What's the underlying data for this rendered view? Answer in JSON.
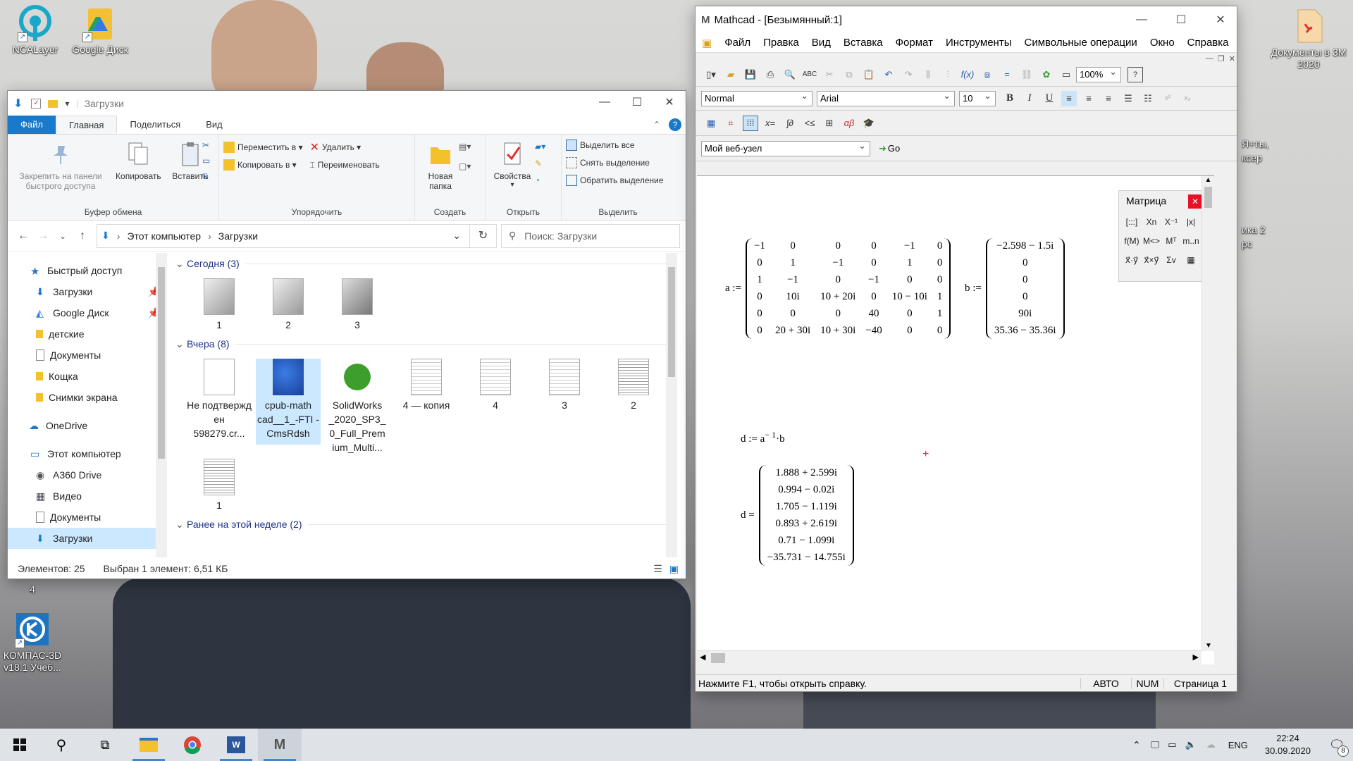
{
  "desktop": {
    "icons": [
      {
        "label": "NCALayer",
        "icon": "ncalayer-icon"
      },
      {
        "label": "Google Диск",
        "icon": "google-drive-icon"
      },
      {
        "label": "КОМПАС-3D v18.1 Учеб...",
        "icon": "kompas-icon"
      },
      {
        "label": "Документы в 3М 2020",
        "icon": "pdf-doc-icon"
      }
    ],
    "partial_labels": [
      "Я+ты,",
      "ксер",
      "ика 2",
      "рс",
      "4"
    ]
  },
  "explorer": {
    "title": "Загрузки",
    "tabs": [
      "Файл",
      "Главная",
      "Поделиться",
      "Вид"
    ],
    "ribbon": {
      "clipboard": {
        "pin_label": "Закрепить на панели быстрого доступа",
        "copy_label": "Копировать",
        "paste_label": "Вставить",
        "group_label": "Буфер обмена"
      },
      "organize": {
        "move_label": "Переместить в",
        "copy_to_label": "Копировать в",
        "delete_label": "Удалить",
        "rename_label": "Переименовать",
        "group_label": "Упорядочить"
      },
      "create": {
        "new_folder_label": "Новая папка",
        "group_label": "Создать"
      },
      "open": {
        "properties_label": "Свойства",
        "group_label": "Открыть"
      },
      "select": {
        "select_all": "Выделить все",
        "deselect": "Снять выделение",
        "invert": "Обратить выделение",
        "group_label": "Выделить"
      }
    },
    "address": {
      "crumbs": [
        "Этот компьютер",
        "Загрузки"
      ],
      "search_placeholder": "Поиск: Загрузки"
    },
    "nav": [
      {
        "label": "Быстрый доступ",
        "icon": "star-icon"
      },
      {
        "label": "Загрузки",
        "icon": "download-icon",
        "pinned": true
      },
      {
        "label": "Google Диск",
        "icon": "google-drive-icon",
        "pinned": true
      },
      {
        "label": "детские",
        "icon": "folder-icon"
      },
      {
        "label": "Документы",
        "icon": "documents-icon"
      },
      {
        "label": "Кощка",
        "icon": "folder-icon"
      },
      {
        "label": "Снимки экрана",
        "icon": "folder-icon"
      },
      {
        "label": "OneDrive",
        "icon": "cloud-icon"
      },
      {
        "label": "Этот компьютер",
        "icon": "computer-icon"
      },
      {
        "label": "A360 Drive",
        "icon": "drive-icon"
      },
      {
        "label": "Видео",
        "icon": "video-icon"
      },
      {
        "label": "Документы",
        "icon": "documents-icon"
      },
      {
        "label": "Загрузки",
        "icon": "download-icon",
        "selected": true
      }
    ],
    "groups": [
      {
        "name": "Сегодня (3)",
        "items": [
          "1",
          "2",
          "3"
        ]
      },
      {
        "name": "Вчера (8)",
        "items": [
          "Не подтвержд ен 598279.cr...",
          "cpub-math cad__1_-FTI -CmsRdsh",
          "SolidWorks _2020_SP3_ 0_Full_Prem ium_Multi...",
          "4 — копия",
          "4",
          "3",
          "2",
          "1"
        ]
      },
      {
        "name": "Ранее на этой неделе (2)",
        "items": []
      }
    ],
    "status": {
      "count": "Элементов: 25",
      "selection": "Выбран 1 элемент: 6,51 КБ"
    }
  },
  "mathcad": {
    "title": "Mathcad - [Безымянный:1]",
    "menu": [
      "Файл",
      "Правка",
      "Вид",
      "Вставка",
      "Формат",
      "Инструменты",
      "Символьные операции",
      "Окно",
      "Справка"
    ],
    "zoom": "100%",
    "style": "Normal",
    "font": "Arial",
    "size": "10",
    "web_node": "Мой веб-узел",
    "go": "Go",
    "palette": {
      "title": "Матрица",
      "cells": [
        "[:::]",
        "Xn",
        "X⁻¹",
        "|x|",
        "f(M)",
        "M<>",
        "Mᵀ",
        "m..n",
        "x⃗·y⃗",
        "x⃗×y⃗",
        "Σv",
        "▦"
      ]
    },
    "a_label": "a :=",
    "a_rows": [
      [
        "−1",
        "0",
        "0",
        "0",
        "−1",
        "0"
      ],
      [
        "0",
        "1",
        "−1",
        "0",
        "1",
        "0"
      ],
      [
        "1",
        "−1",
        "0",
        "−1",
        "0",
        "0"
      ],
      [
        "0",
        "10i",
        "10 + 20i",
        "0",
        "10 − 10i",
        "1"
      ],
      [
        "0",
        "0",
        "0",
        "40",
        "0",
        "1"
      ],
      [
        "0",
        "20 + 30i",
        "10 + 30i",
        "−40",
        "0",
        "0"
      ]
    ],
    "b_label": "b :=",
    "b_rows": [
      "−2.598 − 1.5i",
      "0",
      "0",
      "0",
      "90i",
      "35.36 − 35.36i"
    ],
    "d_def": {
      "lhs": "d := a",
      "exp": "− 1",
      "rhs": "·b"
    },
    "d_label": "d =",
    "d_rows": [
      "1.888 + 2.599i",
      "0.994 − 0.02i",
      "1.705 − 1.119i",
      "0.893 + 2.619i",
      "0.71 − 1.099i",
      "−35.731 − 14.755i"
    ],
    "status": {
      "hint": "Нажмите F1, чтобы открыть справку.",
      "mode": "АВТО",
      "num": "NUM",
      "page": "Страница 1"
    }
  },
  "taskbar": {
    "apps": [
      "start-icon",
      "search-icon",
      "task-view-icon",
      "file-explorer-icon",
      "chrome-icon",
      "word-icon",
      "mathcad-icon"
    ],
    "lang": "ENG",
    "time": "22:24",
    "date": "30.09.2020",
    "notif_count": "8"
  }
}
